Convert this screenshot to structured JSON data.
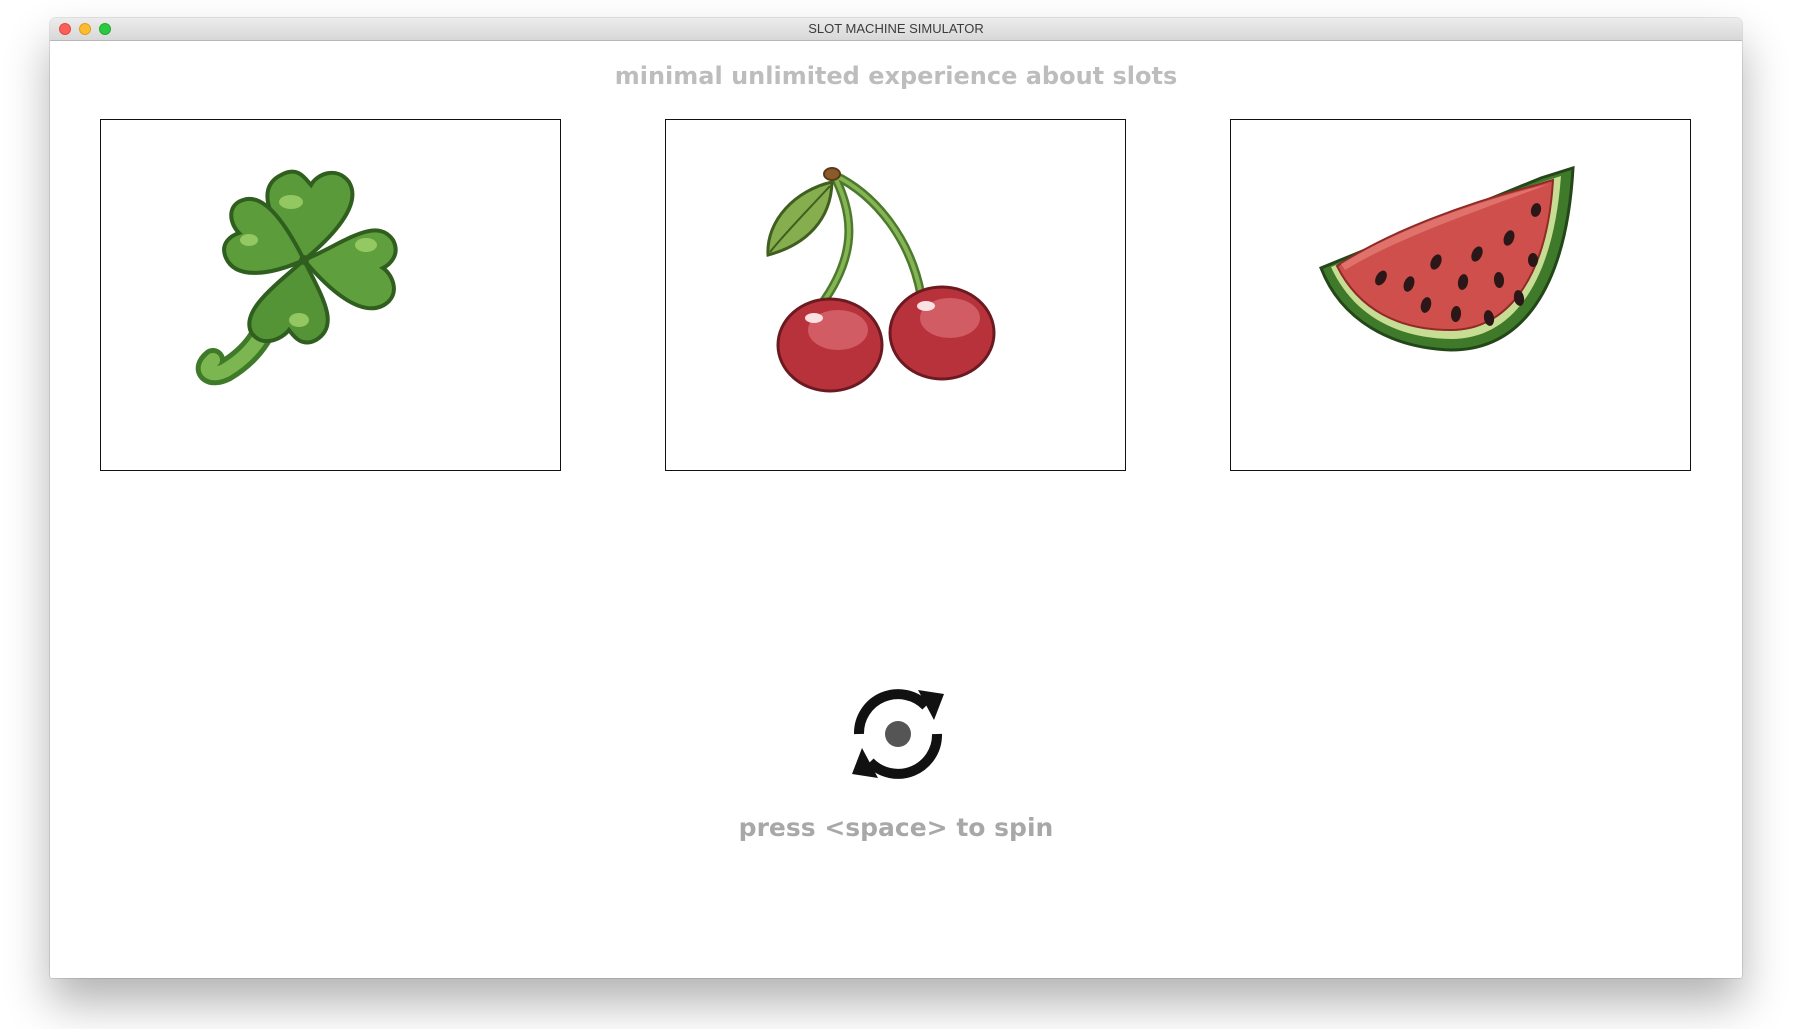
{
  "window": {
    "title": "SLOT MACHINE SIMULATOR"
  },
  "header": {
    "subtitle": "minimal unlimited experience about slots"
  },
  "reels": [
    {
      "symbol": "four-leaf-clover"
    },
    {
      "symbol": "cherries"
    },
    {
      "symbol": "watermelon-slice"
    }
  ],
  "spin": {
    "icon": "refresh-icon",
    "hint": "press <space> to spin"
  },
  "colors": {
    "subtitle": "#bdbdbd",
    "hint": "#a8a8a8",
    "reel_border": "#111111"
  }
}
